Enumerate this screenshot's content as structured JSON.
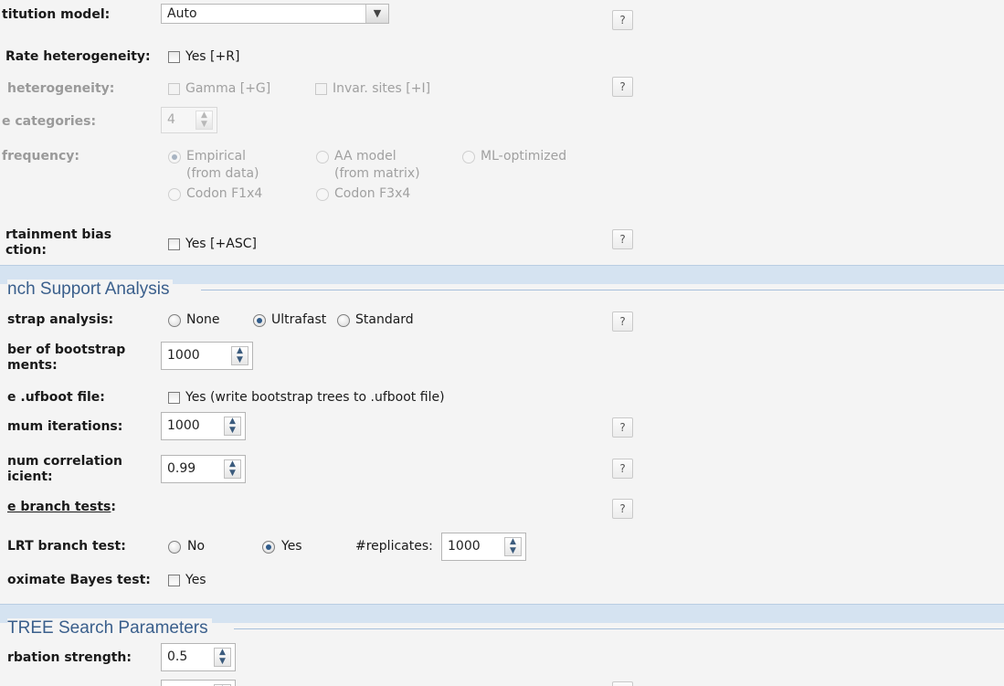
{
  "model": {
    "substitution_label": "titution model:",
    "substitution_value": "Auto",
    "rate_het_label": "Rate heterogeneity:",
    "rate_het_opt": "Yes [+R]",
    "het_label": "heterogeneity:",
    "gamma_opt": "Gamma [+G]",
    "invar_opt": "Invar. sites [+I]",
    "categories_label": "e categories:",
    "categories_value": "4",
    "freq_label": "frequency:",
    "freq_empirical_1": "Empirical",
    "freq_empirical_2": "(from data)",
    "freq_aa_1": "AA model",
    "freq_aa_2": "(from matrix)",
    "freq_ml": "ML-optimized",
    "freq_f1x4": "Codon F1x4",
    "freq_f3x4": "Codon F3x4",
    "asc_label_1": "rtainment bias",
    "asc_label_2": "ction:",
    "asc_opt": "Yes [+ASC]",
    "help": "?"
  },
  "branch": {
    "section_title": "nch Support Analysis",
    "bootstrap_label": "strap analysis:",
    "bootstrap_none": "None",
    "bootstrap_ultrafast": "Ultrafast",
    "bootstrap_standard": "Standard",
    "replicates_label_1": "ber of bootstrap",
    "replicates_label_2": "ments:",
    "replicates_value": "1000",
    "ufboot_label": "e .ufboot file:",
    "ufboot_opt": "Yes (write bootstrap trees to .ufboot file)",
    "max_iter_label": "mum iterations:",
    "max_iter_value": "1000",
    "min_corr_label_1": "num correlation",
    "min_corr_label_2": "icient:",
    "min_corr_value": "0.99",
    "single_branch_label": "e branch tests",
    "single_branch_colon": ":",
    "alrt_label": "LRT branch test:",
    "alrt_no": "No",
    "alrt_yes": "Yes",
    "alrt_replicates_label": "#replicates:",
    "alrt_replicates_value": "1000",
    "abayes_label": "oximate Bayes test:",
    "abayes_opt": "Yes"
  },
  "search": {
    "section_title": "TREE Search Parameters",
    "perturbation_label": "rbation strength:",
    "perturbation_value": "0.5"
  },
  "colors": {
    "section_band": "#d5e3f1",
    "section_title": "#3a5f8c",
    "radio_selected": "#2f5b8a"
  }
}
